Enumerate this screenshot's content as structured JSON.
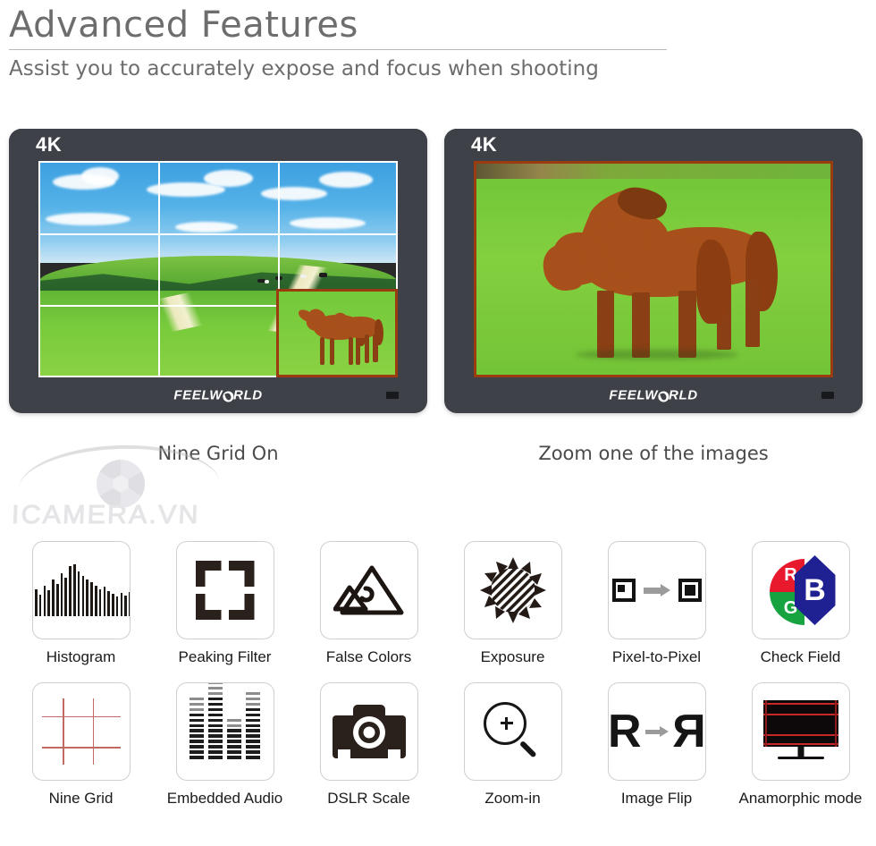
{
  "header": {
    "title": "Advanced Features",
    "subtitle": "Assist you to accurately expose and focus when shooting"
  },
  "monitors": [
    {
      "badge": "4K",
      "brand_pre": "FEELW",
      "brand_post": "RLD",
      "caption": "Nine Grid On",
      "mode": "nine-grid",
      "bezel_color": "#3e4248",
      "grid_line_color": "#ffffff",
      "zoom_box_color": "#9a3b10"
    },
    {
      "badge": "4K",
      "brand_pre": "FEELW",
      "brand_post": "RLD",
      "caption": "Zoom one of the images",
      "mode": "zoomed",
      "bezel_color": "#3e4248",
      "grid_line_color": "#ffffff",
      "zoom_box_color": "#9a3b10"
    }
  ],
  "watermark": {
    "text": "ICAMERA.VN"
  },
  "features": {
    "row1": [
      {
        "label": "Histogram",
        "icon": "histogram-icon"
      },
      {
        "label": "Peaking Filter",
        "icon": "peaking-filter-icon"
      },
      {
        "label": "False Colors",
        "icon": "false-colors-icon"
      },
      {
        "label": "Exposure",
        "icon": "exposure-sun-icon"
      },
      {
        "label": "Pixel-to-Pixel",
        "icon": "pixel-to-pixel-icon"
      },
      {
        "label": "Check Field",
        "icon": "check-field-rgb-icon"
      }
    ],
    "row2": [
      {
        "label": "Nine Grid",
        "icon": "nine-grid-icon"
      },
      {
        "label": "Embedded  Audio",
        "icon": "embedded-audio-icon"
      },
      {
        "label": "DSLR Scale",
        "icon": "dslr-camera-icon"
      },
      {
        "label": "Zoom-in",
        "icon": "magnifier-plus-icon"
      },
      {
        "label": "Image Flip",
        "icon": "image-flip-icon"
      },
      {
        "label": "Anamorphic  mode",
        "icon": "anamorphic-monitor-icon"
      }
    ]
  },
  "check_field": {
    "r": "R",
    "g": "G",
    "b": "B",
    "red": "#e8192c",
    "green": "#17a340",
    "blue": "#1f2192"
  },
  "image_flip": {
    "from": "R",
    "to": "R"
  },
  "histogram_bars": [
    26,
    22,
    30,
    24,
    34,
    29,
    41,
    36,
    48,
    43,
    56,
    58,
    50,
    45,
    41,
    38,
    34,
    30,
    33,
    28,
    25,
    22,
    26,
    23,
    27,
    24
  ],
  "audio_levels": [
    {
      "dark": 9,
      "grey": 3
    },
    {
      "dark": 12,
      "grey": 4
    },
    {
      "dark": 6,
      "grey": 2
    },
    {
      "dark": 10,
      "grey": 3
    }
  ]
}
